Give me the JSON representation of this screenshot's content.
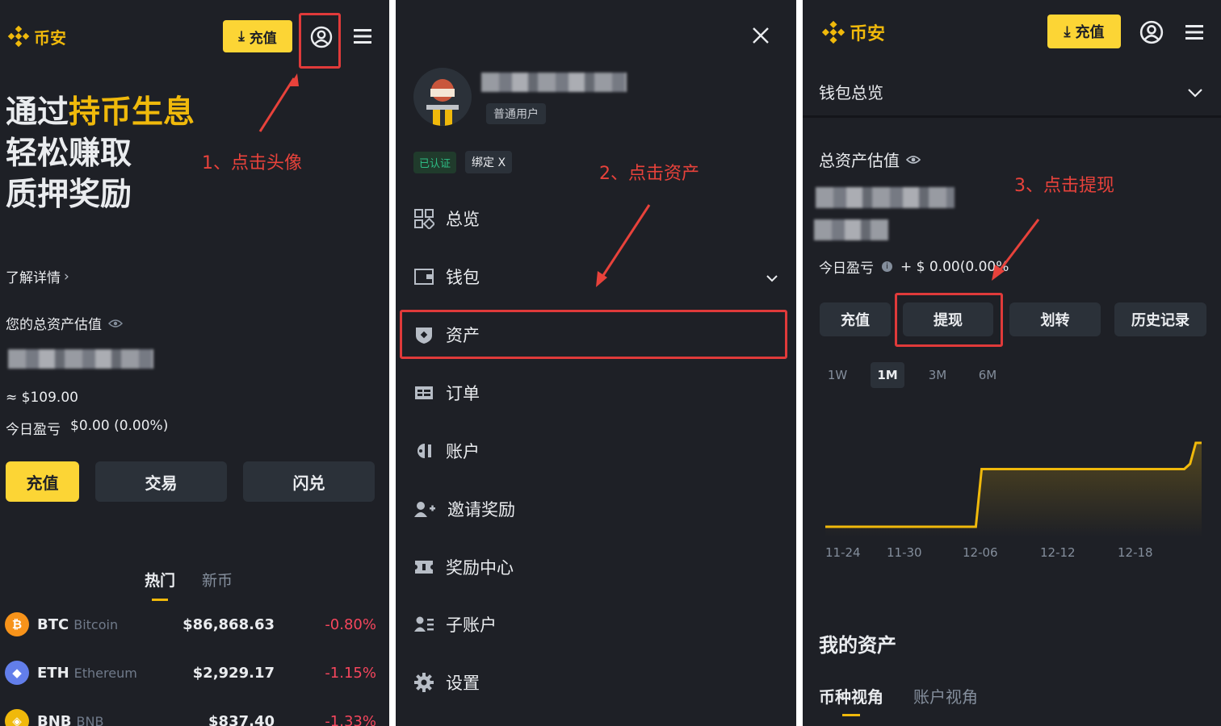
{
  "brand": {
    "name": "币安",
    "accent": "#fcd535",
    "bg": "#1e2026",
    "red": "#e8423b",
    "yellow": "#f0b90b"
  },
  "panel1": {
    "deposit_label": "充值",
    "hero_line1_a": "通过",
    "hero_line1_b": "持币生息",
    "hero_line2": "轻松赚取",
    "hero_line3": "质押奖励",
    "annotation": "1、点击头像",
    "learn_more": "了解详情",
    "total_label": "您的总资产估值",
    "approx_value": "≈ $109.00",
    "pnl_label": "今日盈亏",
    "pnl_value": "$0.00 (0.00%)",
    "actions": [
      "充值",
      "交易",
      "闪兑"
    ],
    "tabs": [
      "热门",
      "新币"
    ],
    "coins": [
      {
        "symbol": "BTC",
        "name": "Bitcoin",
        "price": "$86,868.63",
        "change": "-0.80%",
        "color": "#f7931a",
        "glyph": "₿"
      },
      {
        "symbol": "ETH",
        "name": "Ethereum",
        "price": "$2,929.17",
        "change": "-1.15%",
        "color": "#627eea",
        "glyph": "◆"
      },
      {
        "symbol": "BNB",
        "name": "BNB",
        "price": "$837.40",
        "change": "-1.33%",
        "color": "#f0b90b",
        "glyph": "◈"
      }
    ]
  },
  "panel2": {
    "user_type": "普通用户",
    "verified": "已认证",
    "bind": "绑定 X",
    "annotation": "2、点击资产",
    "menu": [
      {
        "label": "总览",
        "icon": "grid-icon"
      },
      {
        "label": "钱包",
        "icon": "wallet-icon"
      },
      {
        "label": "资产",
        "icon": "asset-shield-icon"
      },
      {
        "label": "订单",
        "icon": "order-icon"
      },
      {
        "label": "账户",
        "icon": "account-icon"
      },
      {
        "label": "邀请奖励",
        "icon": "invite-icon"
      },
      {
        "label": "奖励中心",
        "icon": "ticket-icon"
      },
      {
        "label": "子账户",
        "icon": "sub-account-icon"
      },
      {
        "label": "设置",
        "icon": "gear-icon"
      }
    ]
  },
  "panel3": {
    "deposit_label": "充值",
    "wallet_overview": "钱包总览",
    "total_label": "总资产估值",
    "annotation": "3、点击提现",
    "pnl_label": "今日盈亏",
    "pnl_value": "+ $ 0.00(0.00%",
    "actions": [
      "充值",
      "提现",
      "划转",
      "历史记录"
    ],
    "ranges": [
      "1W",
      "1M",
      "3M",
      "6M"
    ],
    "selected_range": "1M",
    "my_assets": "我的资产",
    "view_tabs": [
      "币种视角",
      "账户视角"
    ]
  },
  "chart_data": {
    "type": "area",
    "x": [
      "11-24",
      "11-30",
      "12-06",
      "12-12",
      "12-18"
    ],
    "series": [
      {
        "values": [
          1,
          1,
          1,
          1,
          1,
          1,
          1,
          1,
          1,
          1,
          1,
          1,
          1,
          1,
          1,
          1,
          1,
          1,
          1,
          1,
          1,
          1,
          1,
          1,
          1,
          1,
          1,
          6.5,
          6.5,
          6.5,
          6.5,
          6.5,
          6.5,
          6.5,
          6.5,
          6.5,
          6.5,
          6.5,
          6.5,
          6.5,
          6.5,
          6.5,
          6.5,
          6.5,
          6.5,
          6.5,
          6.5,
          6.5,
          6.5,
          6.5,
          6.5,
          6.5,
          6.5,
          6.5,
          6.5,
          6.5,
          6.5,
          6.5,
          6.5,
          6.5,
          6.5,
          6.5,
          6.5,
          7.0,
          9.0,
          9.0
        ]
      }
    ],
    "grid": false
  }
}
